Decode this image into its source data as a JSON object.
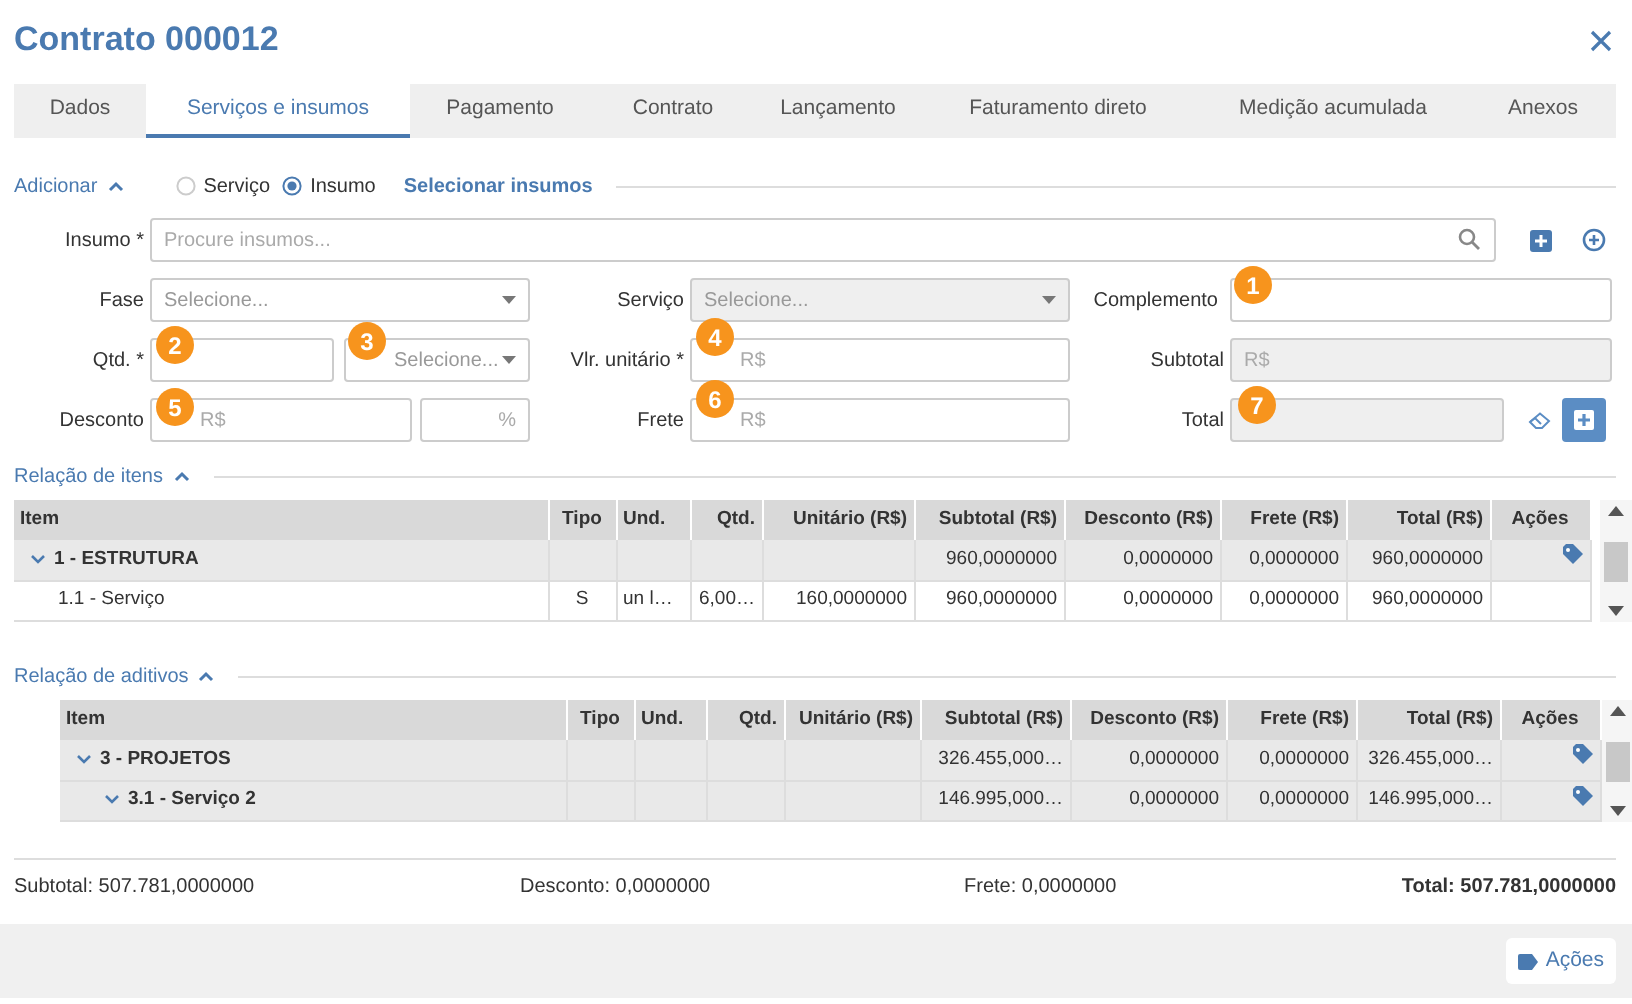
{
  "window": {
    "title": "Contrato 000012"
  },
  "tabs": [
    {
      "label": "Dados",
      "selected": false
    },
    {
      "label": "Serviços e insumos",
      "selected": true
    },
    {
      "label": "Pagamento",
      "selected": false
    },
    {
      "label": "Contrato",
      "selected": false
    },
    {
      "label": "Lançamento",
      "selected": false
    },
    {
      "label": "Faturamento direto",
      "selected": false
    },
    {
      "label": "Medição acumulada",
      "selected": false
    },
    {
      "label": "Anexos",
      "selected": false
    }
  ],
  "add_section": {
    "title": "Adicionar",
    "expanded": true,
    "options": [
      {
        "label": "Serviço",
        "selected": false
      },
      {
        "label": "Insumo",
        "selected": true
      }
    ],
    "link": "Selecionar insumos"
  },
  "form": {
    "insumo": {
      "label": "Insumo *",
      "placeholder": "Procure insumos..."
    },
    "fase": {
      "label": "Fase",
      "placeholder": "Selecione..."
    },
    "servico": {
      "label": "Serviço",
      "placeholder": "Selecione...",
      "disabled": true
    },
    "complemento": {
      "label": "Complemento"
    },
    "qtd": {
      "label": "Qtd. *"
    },
    "unidade": {
      "placeholder": "Selecione..."
    },
    "vlr_unitario": {
      "label": "Vlr. unitário *",
      "placeholder": "R$"
    },
    "subtotal": {
      "label": "Subtotal",
      "placeholder": "R$",
      "disabled": true
    },
    "desconto": {
      "label": "Desconto",
      "placeholder": "R$",
      "percent_placeholder": "%"
    },
    "frete": {
      "label": "Frete",
      "placeholder": "R$"
    },
    "total": {
      "label": "Total",
      "disabled": true
    }
  },
  "markers": [
    "1",
    "2",
    "3",
    "4",
    "5",
    "6",
    "7"
  ],
  "items_section": {
    "title": "Relação de itens",
    "expanded": true,
    "columns": [
      "Item",
      "Tipo",
      "Und.",
      "Qtd.",
      "Unitário (R$)",
      "Subtotal (R$)",
      "Desconto (R$)",
      "Frete (R$)",
      "Total (R$)",
      "Ações"
    ],
    "rows": [
      {
        "kind": "group",
        "expanded": true,
        "tag": true,
        "cells": [
          "1 - ESTRUTURA",
          "",
          "",
          "",
          "",
          "960,0000000",
          "0,0000000",
          "0,0000000",
          "960,0000000"
        ],
        "children": [
          {
            "kind": "item",
            "tag": false,
            "cells": [
              "1.1 - Serviço",
              "S",
              "un l…",
              "6,00…",
              "160,0000000",
              "960,0000000",
              "0,0000000",
              "0,0000000",
              "960,0000000"
            ]
          }
        ]
      }
    ]
  },
  "additives_section": {
    "title": "Relação de aditivos",
    "expanded": true,
    "columns": [
      "Item",
      "Tipo",
      "Und.",
      "Qtd.",
      "Unitário (R$)",
      "Subtotal (R$)",
      "Desconto (R$)",
      "Frete (R$)",
      "Total (R$)",
      "Ações"
    ],
    "rows": [
      {
        "kind": "group",
        "expanded": true,
        "tag": true,
        "cells": [
          "3 - PROJETOS",
          "",
          "",
          "",
          "",
          "326.455,000…",
          "0,0000000",
          "0,0000000",
          "326.455,000…"
        ],
        "children": [
          {
            "kind": "group",
            "expanded": true,
            "tag": true,
            "cells": [
              "3.1 - Serviço 2",
              "",
              "",
              "",
              "",
              "146.995,000…",
              "0,0000000",
              "0,0000000",
              "146.995,000…"
            ]
          }
        ]
      }
    ]
  },
  "summary": [
    {
      "label": "Subtotal:",
      "value": "507.781,0000000",
      "bold": false
    },
    {
      "label": "Desconto:",
      "value": "0,0000000",
      "bold": false
    },
    {
      "label": "Frete:",
      "value": "0,0000000",
      "bold": false
    },
    {
      "label": "Total:",
      "value": "507.781,0000000",
      "bold": true
    }
  ],
  "footer": {
    "button": "Ações"
  }
}
